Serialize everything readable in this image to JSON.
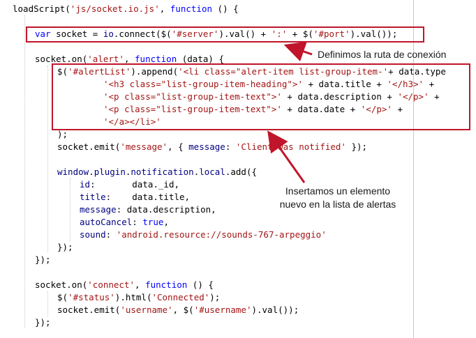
{
  "code_lines": [
    [
      {
        "t": "loadScript(",
        "c": "txt"
      },
      {
        "t": "'js/socket.io.js'",
        "c": "str"
      },
      {
        "t": ", ",
        "c": "txt"
      },
      {
        "t": "function",
        "c": "fn"
      },
      {
        "t": " () {",
        "c": "txt"
      }
    ],
    [],
    [
      {
        "t": "var",
        "c": "fn"
      },
      {
        "t": " socket = ",
        "c": "txt"
      },
      {
        "t": "io",
        "c": "obj"
      },
      {
        "t": ".connect($(",
        "c": "txt"
      },
      {
        "t": "'#server'",
        "c": "str"
      },
      {
        "t": ").val() + ",
        "c": "txt"
      },
      {
        "t": "':'",
        "c": "str"
      },
      {
        "t": " + $(",
        "c": "txt"
      },
      {
        "t": "'#port'",
        "c": "str"
      },
      {
        "t": ").val());",
        "c": "txt"
      }
    ],
    [],
    [
      {
        "t": "socket.on(",
        "c": "txt"
      },
      {
        "t": "'alert'",
        "c": "str"
      },
      {
        "t": ", ",
        "c": "txt"
      },
      {
        "t": "function",
        "c": "fn"
      },
      {
        "t": " (data) {",
        "c": "txt"
      }
    ],
    [
      {
        "t": "$(",
        "c": "txt"
      },
      {
        "t": "'#alertList'",
        "c": "str"
      },
      {
        "t": ").append(",
        "c": "txt"
      },
      {
        "t": "'<li class=\"alert-item list-group-item-'",
        "c": "str"
      },
      {
        "t": "+ data.type",
        "c": "txt"
      }
    ],
    [
      {
        "t": "'<h3 class=\"list-group-item-heading\">'",
        "c": "str"
      },
      {
        "t": " + data.title + ",
        "c": "txt"
      },
      {
        "t": "'</h3>'",
        "c": "str"
      },
      {
        "t": " +",
        "c": "txt"
      }
    ],
    [
      {
        "t": "'<p class=\"list-group-item-text\">'",
        "c": "str"
      },
      {
        "t": " + data.description + ",
        "c": "txt"
      },
      {
        "t": "'</p>'",
        "c": "str"
      },
      {
        "t": " +",
        "c": "txt"
      }
    ],
    [
      {
        "t": "'<p class=\"list-group-item-text\">'",
        "c": "str"
      },
      {
        "t": " + data.date + ",
        "c": "txt"
      },
      {
        "t": "'</p>'",
        "c": "str"
      },
      {
        "t": " +",
        "c": "txt"
      }
    ],
    [
      {
        "t": "'</a></li>'",
        "c": "str"
      }
    ],
    [
      {
        "t": ");",
        "c": "txt"
      }
    ],
    [
      {
        "t": "socket.emit(",
        "c": "txt"
      },
      {
        "t": "'message'",
        "c": "str"
      },
      {
        "t": ", { ",
        "c": "txt"
      },
      {
        "t": "message",
        "c": "obj"
      },
      {
        "t": ": ",
        "c": "txt"
      },
      {
        "t": "'Client was notified'",
        "c": "str"
      },
      {
        "t": " });",
        "c": "txt"
      }
    ],
    [],
    [
      {
        "t": "window",
        "c": "obj"
      },
      {
        "t": ".",
        "c": "txt"
      },
      {
        "t": "plugin",
        "c": "obj"
      },
      {
        "t": ".",
        "c": "txt"
      },
      {
        "t": "notification",
        "c": "obj"
      },
      {
        "t": ".",
        "c": "txt"
      },
      {
        "t": "local",
        "c": "obj"
      },
      {
        "t": ".add({",
        "c": "txt"
      }
    ],
    [
      {
        "t": "id",
        "c": "obj"
      },
      {
        "t": ":       data._id,",
        "c": "txt"
      }
    ],
    [
      {
        "t": "title",
        "c": "obj"
      },
      {
        "t": ":    data.title,",
        "c": "txt"
      }
    ],
    [
      {
        "t": "message",
        "c": "obj"
      },
      {
        "t": ": data.description,",
        "c": "txt"
      }
    ],
    [
      {
        "t": "autoCancel",
        "c": "obj"
      },
      {
        "t": ": ",
        "c": "txt"
      },
      {
        "t": "true",
        "c": "fn"
      },
      {
        "t": ",",
        "c": "txt"
      }
    ],
    [
      {
        "t": "sound",
        "c": "obj"
      },
      {
        "t": ": ",
        "c": "txt"
      },
      {
        "t": "'android.resource://sounds-767-arpeggio'",
        "c": "str"
      }
    ],
    [
      {
        "t": "});",
        "c": "txt"
      }
    ],
    [
      {
        "t": "});",
        "c": "txt"
      }
    ],
    [],
    [
      {
        "t": "socket.on(",
        "c": "txt"
      },
      {
        "t": "'connect'",
        "c": "str"
      },
      {
        "t": ", ",
        "c": "txt"
      },
      {
        "t": "function",
        "c": "fn"
      },
      {
        "t": " () {",
        "c": "txt"
      }
    ],
    [
      {
        "t": "$(",
        "c": "txt"
      },
      {
        "t": "'#status'",
        "c": "str"
      },
      {
        "t": ").html(",
        "c": "txt"
      },
      {
        "t": "'Connected'",
        "c": "str"
      },
      {
        "t": ");",
        "c": "txt"
      }
    ],
    [
      {
        "t": "socket.emit(",
        "c": "txt"
      },
      {
        "t": "'username'",
        "c": "str"
      },
      {
        "t": ", $(",
        "c": "txt"
      },
      {
        "t": "'#username'",
        "c": "str"
      },
      {
        "t": ").val());",
        "c": "txt"
      }
    ],
    [
      {
        "t": "});",
        "c": "txt"
      }
    ]
  ],
  "annotations": {
    "connection": "Definimos la ruta de conexión",
    "insert_line1": "Insertamos un elemento",
    "insert_line2": "nuevo en la lista de alertas"
  },
  "colors": {
    "keyword": "#0000ff",
    "string": "#a31515",
    "object": "#000080",
    "highlight": "#c0152a"
  }
}
